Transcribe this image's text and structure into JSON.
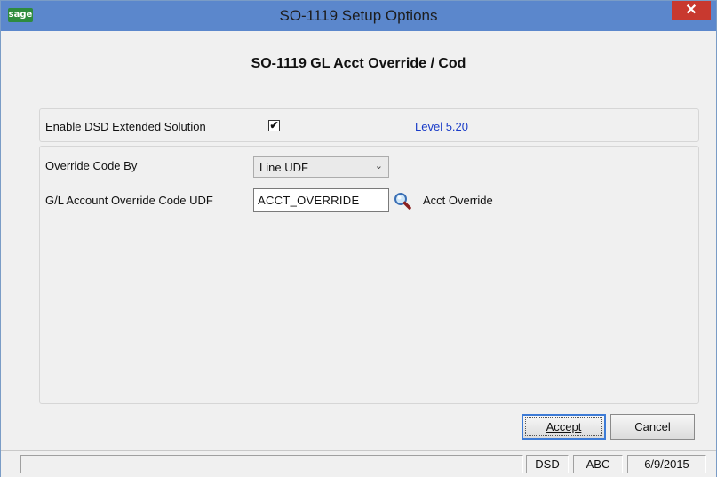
{
  "window": {
    "title": "SO-1119 Setup Options",
    "logo_text": "sage",
    "close_glyph": "✕"
  },
  "header": {
    "title": "SO-1119 GL Acct Override / Cod"
  },
  "enable": {
    "label": "Enable DSD Extended Solution",
    "checked": true,
    "check_glyph": "✔",
    "level": "Level  5.20"
  },
  "override_code_by": {
    "label": "Override Code By",
    "value": "Line UDF",
    "chevron": "⌄"
  },
  "gl_override_udf": {
    "label": "G/L Account Override Code UDF",
    "value": "ACCT_OVERRIDE",
    "description": "Acct Override",
    "lookup_icon": "search-icon"
  },
  "buttons": {
    "accept_label": "Accept",
    "cancel_label": "Cancel"
  },
  "statusbar": {
    "message": "",
    "module": "DSD",
    "company": "ABC",
    "date": "6/9/2015"
  },
  "colors": {
    "titlebar": "#5b87cc",
    "close": "#c8392f",
    "level": "#1a3cc8",
    "accent": "#3d7bd6"
  }
}
